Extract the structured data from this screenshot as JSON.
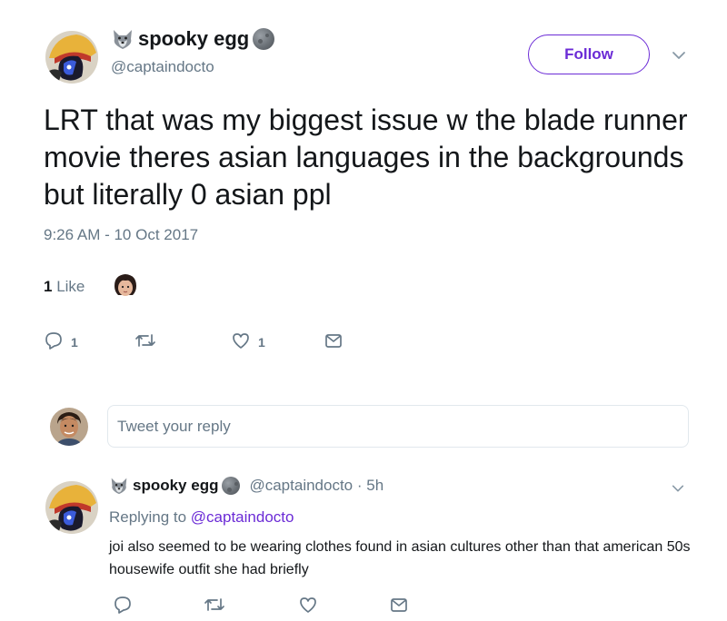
{
  "tweet": {
    "display_name": "spooky egg",
    "handle": "@captaindocto",
    "follow_label": "Follow",
    "text": "LRT that was my biggest issue w the blade runner movie theres asian languages in the backgrounds but literally 0 asian ppl",
    "timestamp": "9:26 AM - 10 Oct 2017",
    "likes_count": "1",
    "likes_label": "Like",
    "reply_count": "1",
    "like_count": "1"
  },
  "composer": {
    "placeholder": "Tweet your reply"
  },
  "reply": {
    "display_name": "spooky egg",
    "handle_time": "@captaindocto · 5h",
    "replying_prefix": "Replying to",
    "replying_mention": "@captaindocto",
    "text": "joi also seemed to be wearing clothes found in asian cultures other than that american 50s housewife outfit she had briefly"
  },
  "icons": {
    "wolf": "wolf-emoji-icon",
    "moon": "new-moon-emoji-icon",
    "reply": "reply-icon",
    "retweet": "retweet-icon",
    "like": "heart-icon",
    "dm": "envelope-icon",
    "more": "chevron-down-icon"
  },
  "colors": {
    "accent": "#6b2bd6",
    "muted": "#657786",
    "text": "#14171a",
    "border": "#e1e8ed"
  }
}
